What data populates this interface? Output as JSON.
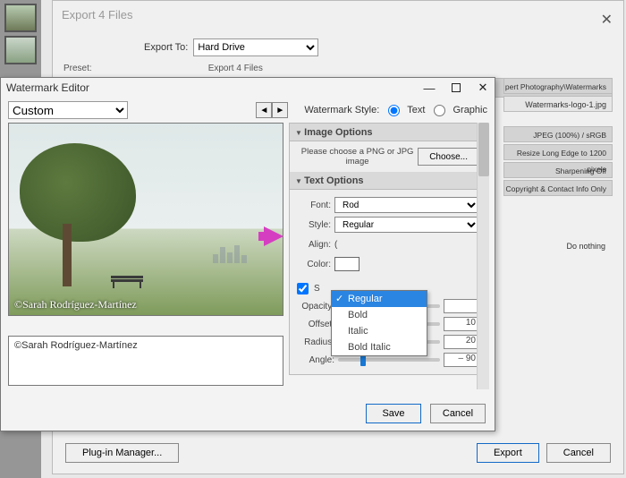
{
  "export": {
    "title": "Export 4 Files",
    "export_to_label": "Export To:",
    "export_to_value": "Hard Drive",
    "preset_label": "Preset:",
    "subheader": "Export 4 Files",
    "right_items": {
      "path": "pert Photography\\Watermarks",
      "filename": "Watermarks-logo-1.jpg",
      "jpeg": "JPEG (100%) / sRGB",
      "resize": "Resize Long Edge to 1200 pixels",
      "sharpen": "Sharpening Off",
      "copyright": "Copyright & Contact Info Only",
      "do_nothing": "Do nothing"
    },
    "plugin_btn": "Plug-in Manager...",
    "export_btn": "Export",
    "cancel_btn": "Cancel"
  },
  "wm": {
    "title": "Watermark Editor",
    "preset_value": "Custom",
    "style_label": "Watermark Style:",
    "style_text": "Text",
    "style_graphic": "Graphic",
    "image_options": "Image Options",
    "image_hint": "Please choose a PNG or JPG image",
    "choose": "Choose...",
    "text_options": "Text Options",
    "font_label": "Font:",
    "font_value": "Rod",
    "style_field_label": "Style:",
    "style_field_value": "Regular",
    "align_label": "Align:",
    "color_label": "Color:",
    "shadow_label": "S",
    "opacity_label": "Opacity:",
    "offset_label": "Offset:",
    "offset_value": "10",
    "radius_label": "Radius:",
    "radius_value": "20",
    "angle_label": "Angle:",
    "angle_value": "– 90",
    "save": "Save",
    "cancel": "Cancel",
    "watermark_preview": "©Sarah Rodríguez-Martínez",
    "watermark_text": "©Sarah Rodríguez-Martínez",
    "dropdown": {
      "regular": "Regular",
      "bold": "Bold",
      "italic": "Italic",
      "bolditalic": "Bold Italic"
    }
  }
}
